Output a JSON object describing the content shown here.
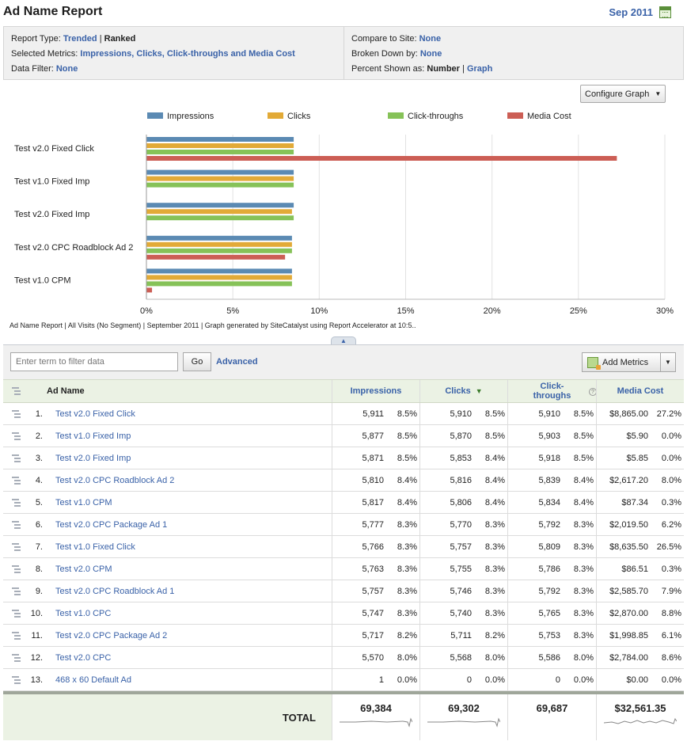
{
  "header": {
    "title": "Ad Name Report",
    "date": "Sep 2011"
  },
  "info": {
    "report_type_label": "Report Type: ",
    "report_type_trended": "Trended",
    "report_type_sep": " | ",
    "report_type_ranked": "Ranked",
    "metrics_label": "Selected Metrics: ",
    "metrics_value": "Impressions, Clicks, Click-throughs and Media Cost",
    "filter_label": "Data Filter: ",
    "filter_value": "None",
    "compare_label": "Compare to Site: ",
    "compare_value": "None",
    "broken_label": "Broken Down by: ",
    "broken_value": "None",
    "percent_label": "Percent Shown as: ",
    "percent_number": "Number",
    "percent_sep": " | ",
    "percent_graph": "Graph"
  },
  "chart_controls": {
    "configure_label": "Configure Graph"
  },
  "chart_data": {
    "type": "bar",
    "orientation": "horizontal",
    "categories": [
      "Test v2.0 Fixed Click",
      "Test v1.0 Fixed Imp",
      "Test v2.0 Fixed Imp",
      "Test v2.0 CPC Roadblock Ad 2",
      "Test v1.0 CPM"
    ],
    "series": [
      {
        "name": "Impressions",
        "color": "#5b8ab3",
        "values": [
          8.5,
          8.5,
          8.5,
          8.4,
          8.4
        ]
      },
      {
        "name": "Clicks",
        "color": "#e2aa37",
        "values": [
          8.5,
          8.5,
          8.4,
          8.4,
          8.4
        ]
      },
      {
        "name": "Click-throughs",
        "color": "#86c258",
        "values": [
          8.5,
          8.5,
          8.5,
          8.4,
          8.4
        ]
      },
      {
        "name": "Media Cost",
        "color": "#cc5e55",
        "values": [
          27.2,
          0.0,
          0.0,
          8.0,
          0.3
        ]
      }
    ],
    "xlim": [
      0,
      30
    ],
    "xticks": [
      "0%",
      "5%",
      "10%",
      "15%",
      "20%",
      "25%",
      "30%"
    ],
    "grid": true,
    "legend": "top"
  },
  "chart_footer": "Ad Name Report | All Visits (No Segment) | September 2011 | Graph generated by SiteCatalyst using Report Accelerator at 10:5..",
  "toolbar": {
    "filter_placeholder": "Enter term to filter data",
    "go_label": "Go",
    "advanced_label": "Advanced",
    "add_metrics_label": "Add Metrics"
  },
  "table": {
    "headers": {
      "name": "Ad Name",
      "impressions": "Impressions",
      "clicks": "Clicks",
      "click_throughs_1": "Click-",
      "click_throughs_2": "throughs",
      "media_cost": "Media Cost"
    },
    "rows": [
      {
        "rank": "1.",
        "name": "Test v2.0 Fixed Click",
        "imp": "5,911",
        "imp_pct": "8.5%",
        "clk": "5,910",
        "clk_pct": "8.5%",
        "ct": "5,910",
        "ct_pct": "8.5%",
        "cost": "$8,865.00",
        "cost_pct": "27.2%"
      },
      {
        "rank": "2.",
        "name": "Test v1.0 Fixed Imp",
        "imp": "5,877",
        "imp_pct": "8.5%",
        "clk": "5,870",
        "clk_pct": "8.5%",
        "ct": "5,903",
        "ct_pct": "8.5%",
        "cost": "$5.90",
        "cost_pct": "0.0%"
      },
      {
        "rank": "3.",
        "name": "Test v2.0 Fixed Imp",
        "imp": "5,871",
        "imp_pct": "8.5%",
        "clk": "5,853",
        "clk_pct": "8.4%",
        "ct": "5,918",
        "ct_pct": "8.5%",
        "cost": "$5.85",
        "cost_pct": "0.0%"
      },
      {
        "rank": "4.",
        "name": "Test v2.0 CPC Roadblock Ad 2",
        "imp": "5,810",
        "imp_pct": "8.4%",
        "clk": "5,816",
        "clk_pct": "8.4%",
        "ct": "5,839",
        "ct_pct": "8.4%",
        "cost": "$2,617.20",
        "cost_pct": "8.0%"
      },
      {
        "rank": "5.",
        "name": "Test v1.0 CPM",
        "imp": "5,817",
        "imp_pct": "8.4%",
        "clk": "5,806",
        "clk_pct": "8.4%",
        "ct": "5,834",
        "ct_pct": "8.4%",
        "cost": "$87.34",
        "cost_pct": "0.3%"
      },
      {
        "rank": "6.",
        "name": "Test v2.0 CPC Package Ad 1",
        "imp": "5,777",
        "imp_pct": "8.3%",
        "clk": "5,770",
        "clk_pct": "8.3%",
        "ct": "5,792",
        "ct_pct": "8.3%",
        "cost": "$2,019.50",
        "cost_pct": "6.2%"
      },
      {
        "rank": "7.",
        "name": "Test v1.0 Fixed Click",
        "imp": "5,766",
        "imp_pct": "8.3%",
        "clk": "5,757",
        "clk_pct": "8.3%",
        "ct": "5,809",
        "ct_pct": "8.3%",
        "cost": "$8,635.50",
        "cost_pct": "26.5%"
      },
      {
        "rank": "8.",
        "name": "Test v2.0 CPM",
        "imp": "5,763",
        "imp_pct": "8.3%",
        "clk": "5,755",
        "clk_pct": "8.3%",
        "ct": "5,786",
        "ct_pct": "8.3%",
        "cost": "$86.51",
        "cost_pct": "0.3%"
      },
      {
        "rank": "9.",
        "name": "Test v2.0 CPC Roadblock Ad 1",
        "imp": "5,757",
        "imp_pct": "8.3%",
        "clk": "5,746",
        "clk_pct": "8.3%",
        "ct": "5,792",
        "ct_pct": "8.3%",
        "cost": "$2,585.70",
        "cost_pct": "7.9%"
      },
      {
        "rank": "10.",
        "name": "Test v1.0 CPC",
        "imp": "5,747",
        "imp_pct": "8.3%",
        "clk": "5,740",
        "clk_pct": "8.3%",
        "ct": "5,765",
        "ct_pct": "8.3%",
        "cost": "$2,870.00",
        "cost_pct": "8.8%"
      },
      {
        "rank": "11.",
        "name": "Test v2.0 CPC Package Ad 2",
        "imp": "5,717",
        "imp_pct": "8.2%",
        "clk": "5,711",
        "clk_pct": "8.2%",
        "ct": "5,753",
        "ct_pct": "8.3%",
        "cost": "$1,998.85",
        "cost_pct": "6.1%"
      },
      {
        "rank": "12.",
        "name": "Test v2.0 CPC",
        "imp": "5,570",
        "imp_pct": "8.0%",
        "clk": "5,568",
        "clk_pct": "8.0%",
        "ct": "5,586",
        "ct_pct": "8.0%",
        "cost": "$2,784.00",
        "cost_pct": "8.6%"
      },
      {
        "rank": "13.",
        "name": "468 x 60 Default Ad",
        "imp": "1",
        "imp_pct": "0.0%",
        "clk": "0",
        "clk_pct": "0.0%",
        "ct": "0",
        "ct_pct": "0.0%",
        "cost": "$0.00",
        "cost_pct": "0.0%"
      }
    ],
    "total": {
      "label": "TOTAL",
      "imp": "69,384",
      "clk": "69,302",
      "ct": "69,687",
      "cost": "$32,561.35"
    }
  }
}
